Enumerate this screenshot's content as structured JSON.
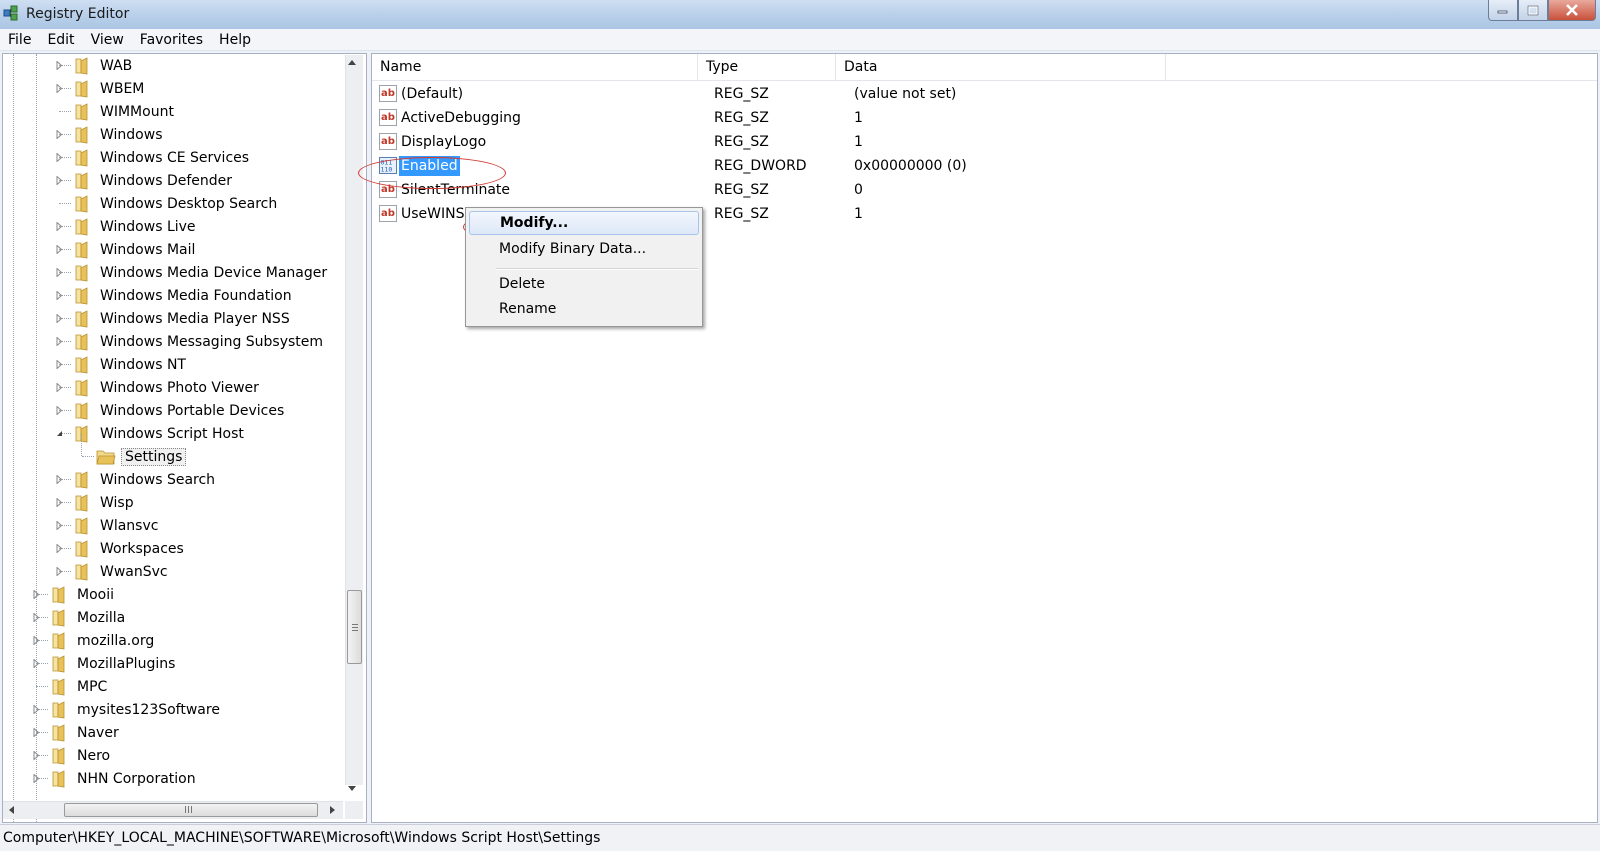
{
  "window": {
    "title": "Registry Editor",
    "controls": {
      "minimize": "minimize-icon",
      "maximize": "restore-icon",
      "close": "close-icon"
    }
  },
  "menu": [
    "File",
    "Edit",
    "View",
    "Favorites",
    "Help"
  ],
  "tree": {
    "items": [
      {
        "label": "WAB",
        "level": 2,
        "expandable": true
      },
      {
        "label": "WBEM",
        "level": 2,
        "expandable": true
      },
      {
        "label": "WIMMount",
        "level": 2,
        "expandable": false
      },
      {
        "label": "Windows",
        "level": 2,
        "expandable": true
      },
      {
        "label": "Windows CE Services",
        "level": 2,
        "expandable": true
      },
      {
        "label": "Windows Defender",
        "level": 2,
        "expandable": true
      },
      {
        "label": "Windows Desktop Search",
        "level": 2,
        "expandable": false
      },
      {
        "label": "Windows Live",
        "level": 2,
        "expandable": true
      },
      {
        "label": "Windows Mail",
        "level": 2,
        "expandable": true
      },
      {
        "label": "Windows Media Device Manager",
        "level": 2,
        "expandable": true
      },
      {
        "label": "Windows Media Foundation",
        "level": 2,
        "expandable": true
      },
      {
        "label": "Windows Media Player NSS",
        "level": 2,
        "expandable": true
      },
      {
        "label": "Windows Messaging Subsystem",
        "level": 2,
        "expandable": true
      },
      {
        "label": "Windows NT",
        "level": 2,
        "expandable": true
      },
      {
        "label": "Windows Photo Viewer",
        "level": 2,
        "expandable": true
      },
      {
        "label": "Windows Portable Devices",
        "level": 2,
        "expandable": true
      },
      {
        "label": "Windows Script Host",
        "level": 2,
        "expandable": true,
        "expanded": true
      },
      {
        "label": "Settings",
        "level": 3,
        "expandable": false,
        "selected": true
      },
      {
        "label": "Windows Search",
        "level": 2,
        "expandable": true
      },
      {
        "label": "Wisp",
        "level": 2,
        "expandable": true
      },
      {
        "label": "Wlansvc",
        "level": 2,
        "expandable": true
      },
      {
        "label": "Workspaces",
        "level": 2,
        "expandable": true
      },
      {
        "label": "WwanSvc",
        "level": 2,
        "expandable": true
      },
      {
        "label": "Mooii",
        "level": 1,
        "expandable": true
      },
      {
        "label": "Mozilla",
        "level": 1,
        "expandable": true
      },
      {
        "label": "mozilla.org",
        "level": 1,
        "expandable": true
      },
      {
        "label": "MozillaPlugins",
        "level": 1,
        "expandable": true
      },
      {
        "label": "MPC",
        "level": 1,
        "expandable": false
      },
      {
        "label": "mysites123Software",
        "level": 1,
        "expandable": true
      },
      {
        "label": "Naver",
        "level": 1,
        "expandable": true
      },
      {
        "label": "Nero",
        "level": 1,
        "expandable": true
      },
      {
        "label": "NHN Corporation",
        "level": 1,
        "expandable": true
      }
    ]
  },
  "values": {
    "columns": [
      "Name",
      "Type",
      "Data"
    ],
    "rows": [
      {
        "name": "(Default)",
        "type": "REG_SZ",
        "data": "(value not set)",
        "icon": "string-value-icon"
      },
      {
        "name": "ActiveDebugging",
        "type": "REG_SZ",
        "data": "1",
        "icon": "string-value-icon"
      },
      {
        "name": "DisplayLogo",
        "type": "REG_SZ",
        "data": "1",
        "icon": "string-value-icon"
      },
      {
        "name": "Enabled",
        "type": "REG_DWORD",
        "data": "0x00000000 (0)",
        "icon": "binary-value-icon",
        "selected": true
      },
      {
        "name": "SilentTerminate",
        "type": "REG_SZ",
        "data": "0",
        "icon": "string-value-icon"
      },
      {
        "name": "UseWINS",
        "type": "REG_SZ",
        "data": "1",
        "icon": "string-value-icon"
      }
    ]
  },
  "context_menu": {
    "items": [
      "Modify...",
      "Modify Binary Data...",
      "Delete",
      "Rename"
    ]
  },
  "status": {
    "path": "Computer\\HKEY_LOCAL_MACHINE\\SOFTWARE\\Microsoft\\Windows Script Host\\Settings"
  },
  "colors": {
    "selection": "#3399ff",
    "annotation": "#d23a33",
    "folder": "#e8c15a",
    "string_icon": "#c0392b",
    "binary_icon": "#1f5fb4"
  }
}
